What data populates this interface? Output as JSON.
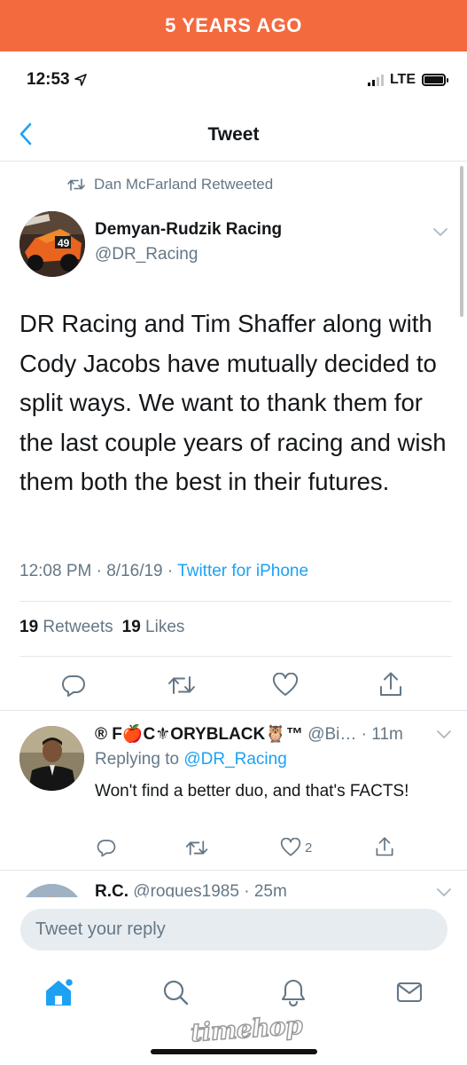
{
  "banner": {
    "text": "5 YEARS AGO"
  },
  "status_bar": {
    "time": "12:53",
    "network": "LTE"
  },
  "nav": {
    "title": "Tweet"
  },
  "retweet_context": "Dan McFarland Retweeted",
  "tweet": {
    "author_name": "Demyan-Rudzik Racing",
    "author_handle": "@DR_Racing",
    "text": "DR Racing and Tim Shaffer along with Cody Jacobs have mutually decided to split ways. We want to thank them for the last couple years of racing and wish them both the best in their futures.",
    "time": "12:08 PM",
    "date": "8/16/19",
    "source": "Twitter for iPhone",
    "retweets_count": "19",
    "retweets_label": "Retweets",
    "likes_count": "19",
    "likes_label": "Likes"
  },
  "reply": {
    "author_name": "® F🍎C⚜ORYBLACK🦉™",
    "author_handle": "@Bi…",
    "age": "11m",
    "replying_label": "Replying to",
    "replying_to": "@DR_Racing",
    "text": "Won't find a better duo, and that's FACTS!",
    "likes_count": "2"
  },
  "next_reply": {
    "author_name": "R.C.",
    "author_handle": "@rogues1985",
    "age": "25m"
  },
  "composer": {
    "placeholder": "Tweet your reply"
  },
  "watermark": "timehop",
  "colors": {
    "banner": "#f46a3f",
    "twitter_blue": "#1da1f2",
    "muted": "#657786",
    "icon": "#657786"
  },
  "icons": [
    "back-icon",
    "retweet-icon",
    "chevron-down-icon",
    "reply-icon",
    "heart-icon",
    "share-icon",
    "home-icon",
    "search-icon",
    "notifications-icon",
    "messages-icon"
  ]
}
